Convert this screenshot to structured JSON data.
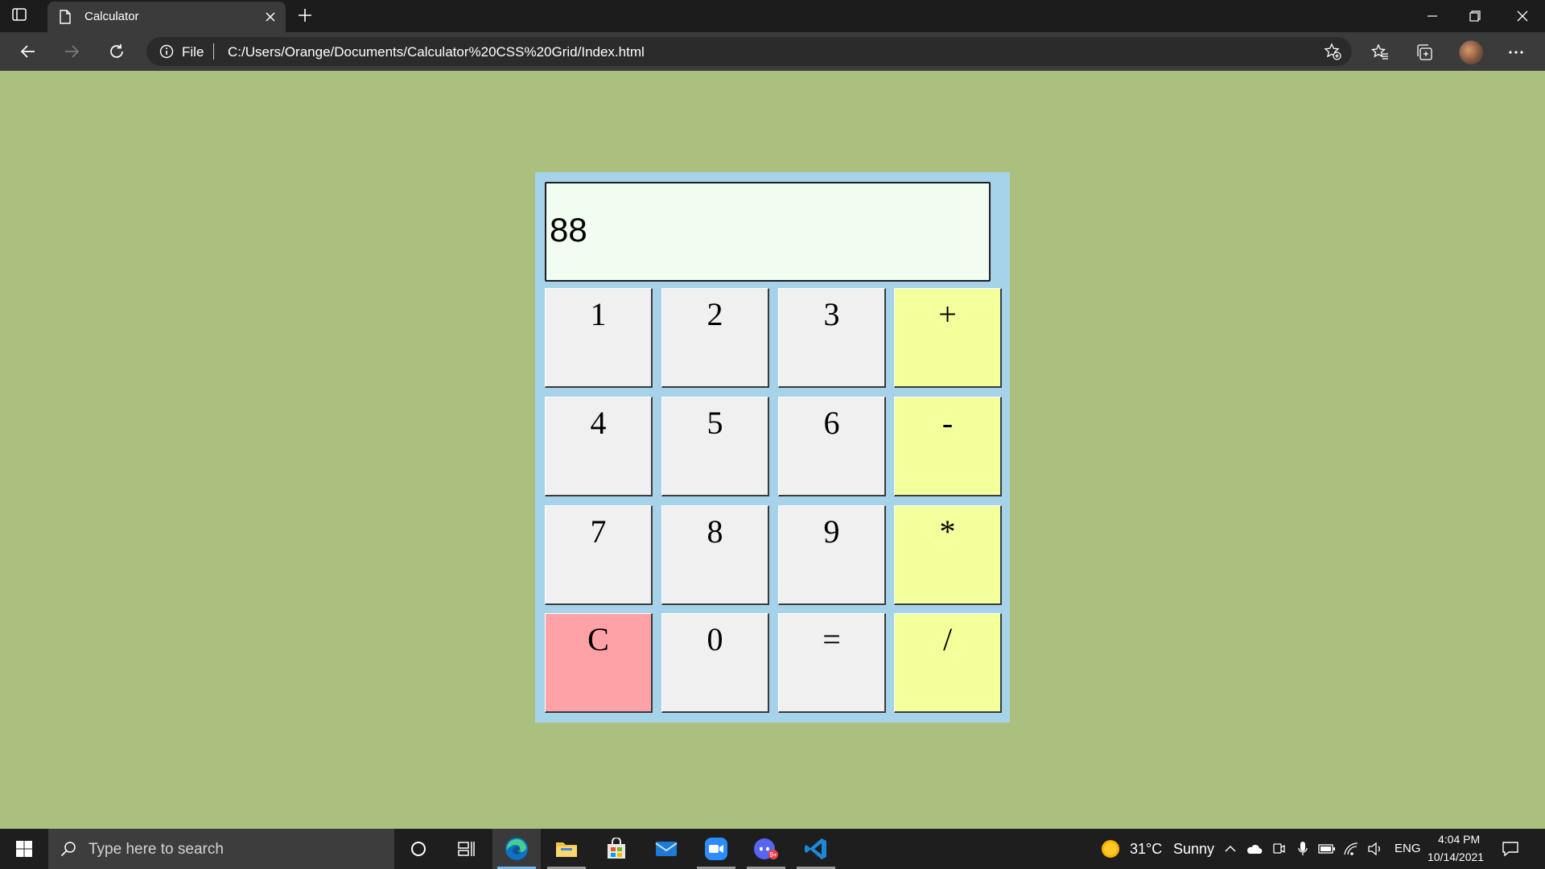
{
  "browser": {
    "tab_title": "Calculator",
    "address_prefix": "File",
    "url": "C:/Users/Orange/Documents/Calculator%20CSS%20Grid/Index.html"
  },
  "calculator": {
    "display_value": "88",
    "keys": [
      "1",
      "2",
      "3",
      "+",
      "4",
      "5",
      "6",
      "-",
      "7",
      "8",
      "9",
      "*",
      "C",
      "0",
      "=",
      "/"
    ]
  },
  "taskbar": {
    "search_placeholder": "Type here to search",
    "weather_temp": "31°C",
    "weather_text": "Sunny",
    "language": "ENG",
    "time": "4:04 PM",
    "date": "10/14/2021"
  },
  "colors": {
    "page_background": "#abc07e",
    "calculator_frame": "#a7d3ea",
    "display_background": "#f1fdf0",
    "digit_key": "#f0f0f0",
    "operator_key": "#f2ff9b",
    "clear_key": "#ffa2a7"
  },
  "icons": [
    "tab-actions-icon",
    "page-icon",
    "close-icon",
    "plus-icon",
    "minimize-icon",
    "restore-icon",
    "back-icon",
    "forward-icon",
    "refresh-icon",
    "info-icon",
    "add-favorite-icon",
    "favorites-icon",
    "collections-icon",
    "more-icon",
    "windows-icon",
    "search-icon",
    "cortana-icon",
    "task-view-icon",
    "edge-icon",
    "file-explorer-icon",
    "store-icon",
    "mail-icon",
    "zoom-icon",
    "discord-icon",
    "vscode-icon",
    "weather-sun-icon",
    "chevron-up-icon",
    "cloud-icon",
    "mic-icon",
    "battery-icon",
    "wifi-icon",
    "speaker-icon",
    "notification-icon"
  ]
}
